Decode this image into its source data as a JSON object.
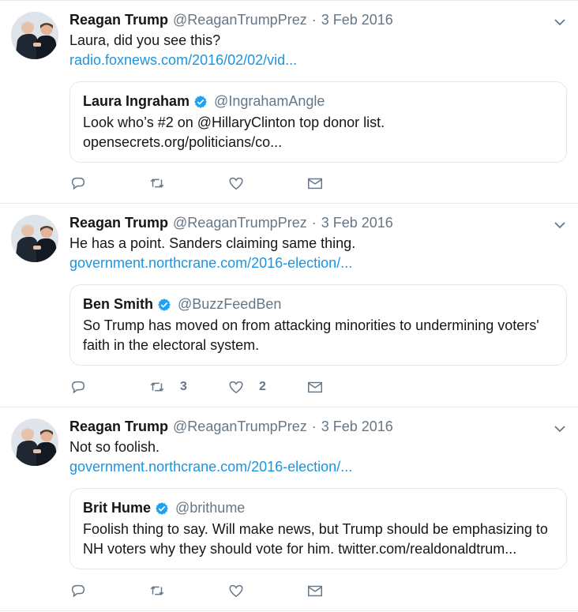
{
  "tweets": [
    {
      "author_name": "Reagan Trump",
      "handle": "@ReaganTrumpPrez",
      "separator": "·",
      "date": "3 Feb 2016",
      "text": "Laura, did you see this?",
      "link": "radio.foxnews.com/2016/02/02/vid...",
      "quote": {
        "name": "Laura Ingraham",
        "handle": "@IngrahamAngle",
        "text": "Look who’s #2 on @HillaryClinton top donor list. opensecrets.org/politicians/co..."
      },
      "retweets": "",
      "likes": ""
    },
    {
      "author_name": "Reagan Trump",
      "handle": "@ReaganTrumpPrez",
      "separator": "·",
      "date": "3 Feb 2016",
      "text": "He has a point. Sanders claiming same thing.",
      "link": "government.northcrane.com/2016-election/...",
      "quote": {
        "name": "Ben Smith",
        "handle": "@BuzzFeedBen",
        "text": "So Trump has moved on from attacking minorities to undermining voters' faith in the electoral system."
      },
      "retweets": "3",
      "likes": "2"
    },
    {
      "author_name": "Reagan Trump",
      "handle": "@ReaganTrumpPrez",
      "separator": "·",
      "date": "3 Feb 2016",
      "text": "Not so foolish.",
      "link": "government.northcrane.com/2016-election/...",
      "quote": {
        "name": "Brit Hume",
        "handle": "@brithume",
        "text": "Foolish thing to say. Will make news, but Trump should be emphasizing to NH voters why they should vote for him.  twitter.com/realdonaldtrum..."
      },
      "retweets": "",
      "likes": ""
    }
  ],
  "icons": {
    "reply": "reply-icon",
    "retweet": "retweet-icon",
    "like": "heart-icon",
    "message": "envelope-icon",
    "verified": "verified-badge-icon",
    "menu": "chevron-down-icon"
  },
  "colors": {
    "link": "#1b95e0",
    "muted": "#657786",
    "verified": "#1da1f2",
    "border": "#e1e8ed"
  }
}
